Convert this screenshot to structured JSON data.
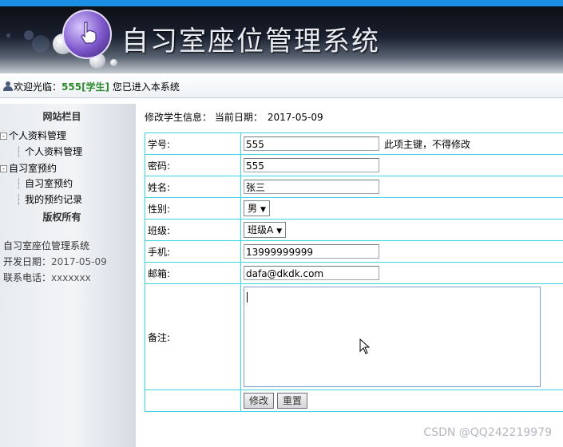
{
  "header": {
    "site_title": "自习室座位管理系统",
    "logo_icon": "hand-pointer-icon"
  },
  "welcome": {
    "prefix": "欢迎光临：",
    "username": "555[学生]",
    "suffix": " 您已进入本系统"
  },
  "sidebar": {
    "title": "网站栏目",
    "menu": [
      {
        "label": "个人资料管理",
        "children": [
          "个人资料管理"
        ]
      },
      {
        "label": "自习室预约",
        "children": [
          "自习室预约",
          "我的预约记录"
        ]
      }
    ],
    "copyright_title": "版权所有",
    "info": {
      "system_name": "自习室座位管理系统",
      "dev_date_label": "开发日期：",
      "dev_date": "2017-05-09",
      "phone_label": "联系电话：",
      "phone": "xxxxxxx"
    }
  },
  "main": {
    "heading": "修改学生信息：",
    "date_label": "当前日期：",
    "date": "2017-05-09",
    "form": {
      "student_id": {
        "label": "学号:",
        "value": "555",
        "hint": "此项主键，不得修改"
      },
      "password": {
        "label": "密码:",
        "value": "555"
      },
      "name": {
        "label": "姓名:",
        "value": "张三"
      },
      "gender": {
        "label": "性别:",
        "value": "男"
      },
      "class": {
        "label": "班级:",
        "value": "班级A"
      },
      "phone": {
        "label": "手机:",
        "value": "13999999999"
      },
      "email": {
        "label": "邮箱:",
        "value": "dafa@dkdk.com"
      },
      "remark": {
        "label": "备注:",
        "value": ""
      },
      "submit_label": "修改",
      "reset_label": "重置"
    }
  },
  "watermark": "CSDN @QQ242219979",
  "colors": {
    "accent_bar": "#1b8fe6",
    "table_border": "#3dd6e2",
    "username": "#2e8a2e"
  }
}
